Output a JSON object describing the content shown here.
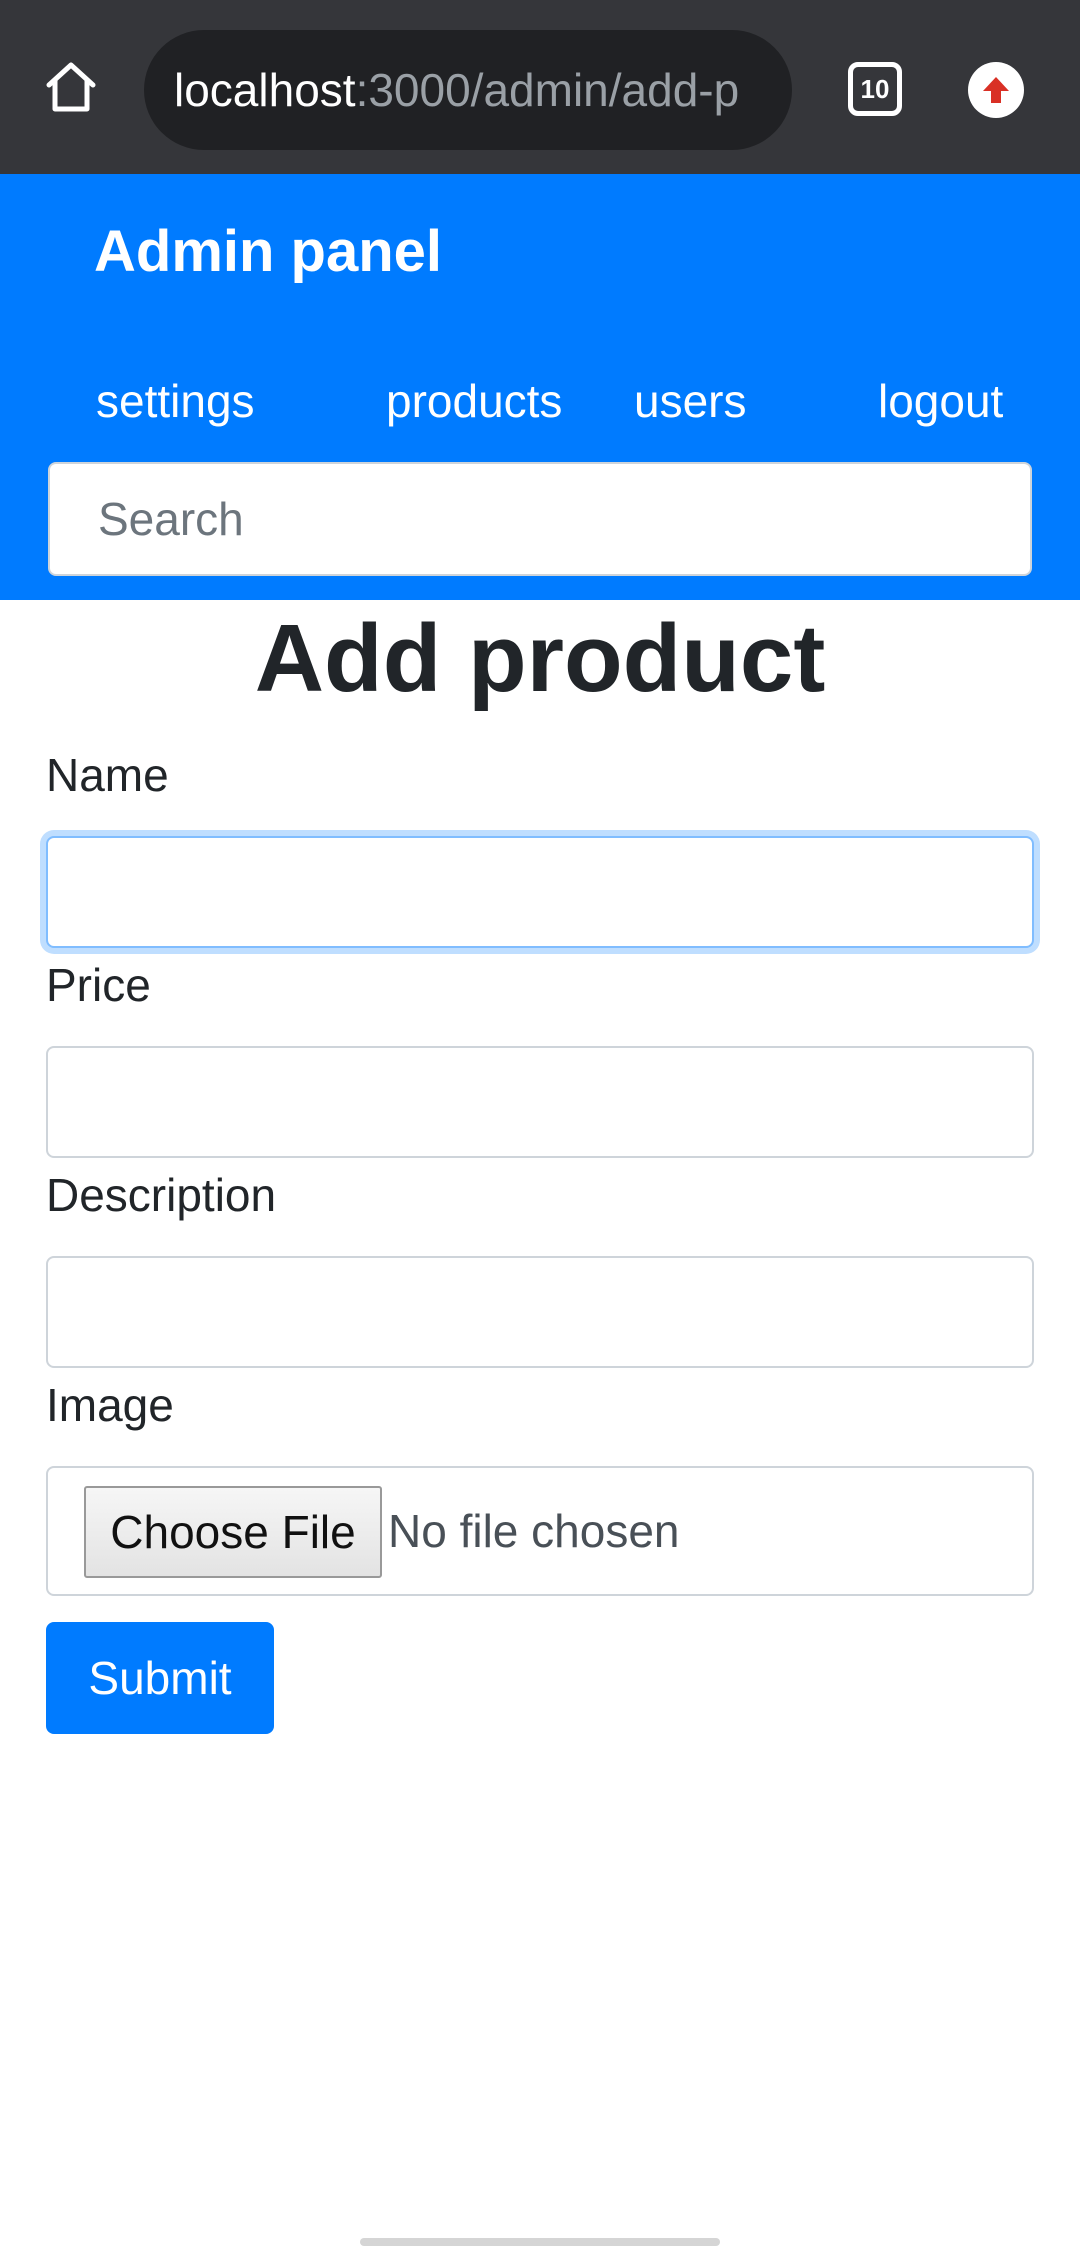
{
  "browser": {
    "url_host": "localhost",
    "url_path": ":3000/admin/add-p",
    "tab_count": "10",
    "home_icon": "home-icon",
    "update_icon": "arrow-up-icon",
    "update_color": "#d93025"
  },
  "header": {
    "brand": "Admin panel",
    "nav": {
      "settings": "settings",
      "products": "products",
      "users": "users",
      "logout": "logout"
    },
    "search_placeholder": "Search",
    "background_color": "#007bff"
  },
  "main": {
    "title": "Add product",
    "fields": {
      "name_label": "Name",
      "price_label": "Price",
      "description_label": "Description",
      "image_label": "Image"
    },
    "file": {
      "button_label": "Choose File",
      "status": "No file chosen"
    },
    "submit_label": "Submit"
  }
}
